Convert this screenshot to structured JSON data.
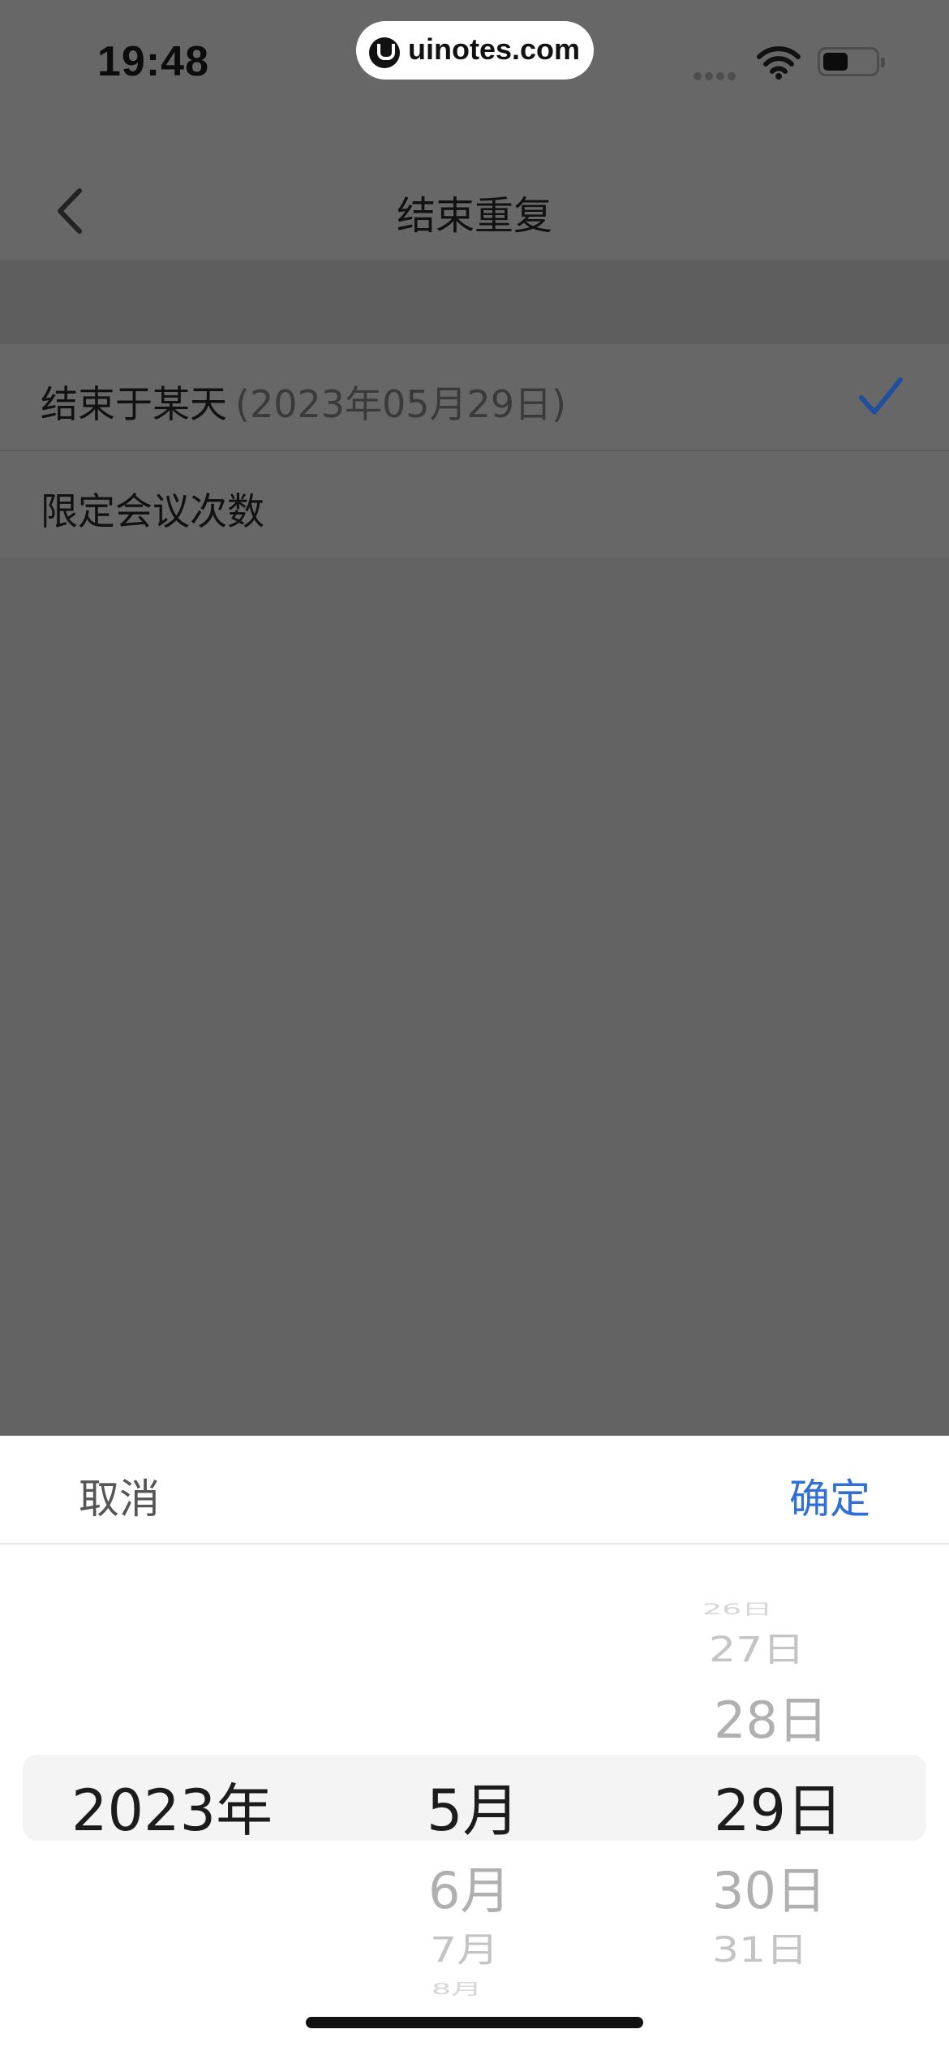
{
  "status_bar": {
    "time": "19:48",
    "site_badge": "uinotes.com",
    "icons": [
      "signal-icon",
      "wifi-icon",
      "battery-icon"
    ]
  },
  "nav": {
    "title": "结束重复",
    "back_icon": "chevron-left-icon"
  },
  "options": [
    {
      "label": "结束于某天",
      "detail": "(2023年05月29日)",
      "selected": true
    },
    {
      "label": "限定会议次数",
      "selected": false
    }
  ],
  "picker": {
    "cancel_label": "取消",
    "confirm_label": "确定",
    "year": {
      "selected": "2023年"
    },
    "month": {
      "selected": "5月",
      "after": [
        "6月",
        "7月",
        "8月"
      ]
    },
    "day": {
      "before": [
        "26日",
        "27日",
        "28日"
      ],
      "selected": "29日",
      "after": [
        "30日",
        "31日"
      ]
    }
  },
  "colors": {
    "accent": "#2f6fd6",
    "check": "#1f4f9e",
    "overlay": "#666666"
  }
}
